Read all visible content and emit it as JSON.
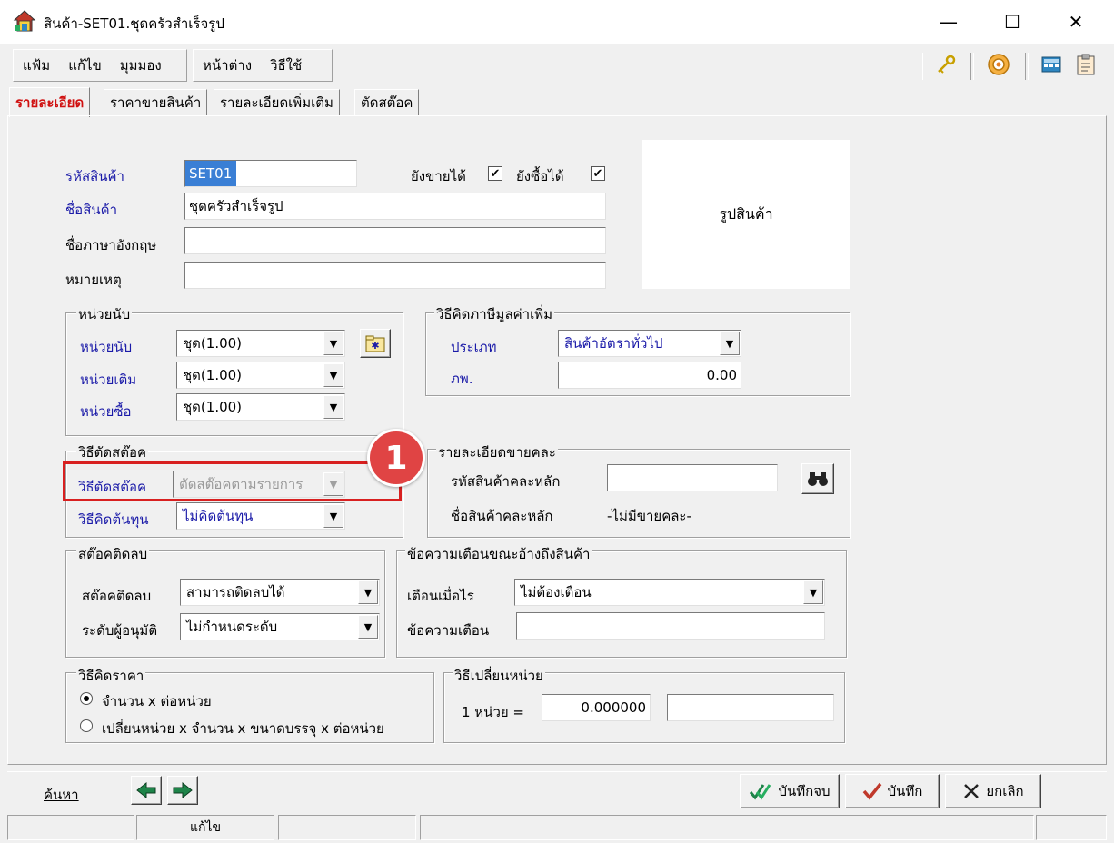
{
  "window": {
    "title": "สินค้า-SET01.ชุดครัวสำเร็จรูป",
    "minimize": "—",
    "maximize": "☐",
    "close": "✕"
  },
  "menu": {
    "file": "แฟ้ม",
    "edit": "แก้ไข",
    "view": "มุมมอง",
    "window": "หน้าต่าง",
    "help": "วิธีใช้"
  },
  "tabs": [
    "รายละเอียด",
    "ราคาขายสินค้า",
    "รายละเอียดเพิ่มเติม",
    "ตัดสต๊อค"
  ],
  "product": {
    "code_label": "รหัสสินค้า",
    "code_value": "SET01",
    "name_label": "ชื่อสินค้า",
    "name_value": "ชุดครัวสำเร็จรูป",
    "eng_name_label": "ชื่อภาษาอังกฤษ",
    "eng_name_value": "",
    "note_label": "หมายเหตุ",
    "note_value": "",
    "still_sell_label": "ยังขายได้",
    "still_buy_label": "ยังซื้อได้",
    "photo_label": "รูปสินค้า"
  },
  "units": {
    "title": "หน่วยนับ",
    "unit_label": "หน่วยนับ",
    "unit_value": "ชุด(1.00)",
    "stock_label": "หน่วยเติม",
    "stock_value": "ชุด(1.00)",
    "buy_label": "หน่วยซื้อ",
    "buy_value": "ชุด(1.00)"
  },
  "vat": {
    "title": "วิธีคิดภาษีมูลค่าเพิ่ม",
    "type_label": "ประเภท",
    "type_value": "สินค้าอัตราทั่วไป",
    "rate_label": "ภพ.",
    "rate_value": "0.00"
  },
  "stock_cut": {
    "title": "วิธีตัดสต๊อค",
    "method_label": "วิธีตัดสต๊อค",
    "method_value": "ตัดสต๊อคตามรายการ",
    "cost_label": "วิธีคิดต้นทุน",
    "cost_value": "ไม่คิดต้นทุน",
    "annotation": "1"
  },
  "mixed_sale": {
    "title": "รายละเอียดขายคละ",
    "main_code_label": "รหัสสินค้าคละหลัก",
    "main_code_value": "",
    "main_name_label": "ชื่อสินค้าคละหลัก",
    "main_name_value": "-ไม่มีขายคละ-"
  },
  "negative_stock": {
    "title": "สต๊อคติดลบ",
    "stock_label": "สต๊อคติดลบ",
    "stock_value": "สามารถติดลบได้",
    "approver_label": "ระดับผู้อนุมัติ",
    "approver_value": "ไม่กำหนดระดับ"
  },
  "warning": {
    "title": "ข้อความเตือนขณะอ้างถึงสินค้า",
    "when_label": "เตือนเมื่อไร",
    "when_value": "ไม่ต้องเตือน",
    "message_label": "ข้อความเตือน",
    "message_value": ""
  },
  "pricing": {
    "title": "วิธีคิดราคา",
    "option1": "จำนวน x ต่อหน่วย",
    "option2": "เปลี่ยนหน่วย x จำนวน x ขนาดบรรจุ x ต่อหน่วย",
    "selected": "option1"
  },
  "unit_convert": {
    "title": "วิธีเปลี่ยนหน่วย",
    "label": "1 หน่วย =",
    "value": "0.000000",
    "unit": ""
  },
  "bottom": {
    "search": "ค้นหา",
    "save_close": "บันทึกจบ",
    "save": "บันทึก",
    "cancel": "ยกเลิก"
  },
  "status": {
    "mode": "แก้ไข"
  },
  "colors": {
    "label_blue": "#1a1aa8",
    "active_tab_red": "#d01010",
    "annotation_red": "#d82020"
  }
}
